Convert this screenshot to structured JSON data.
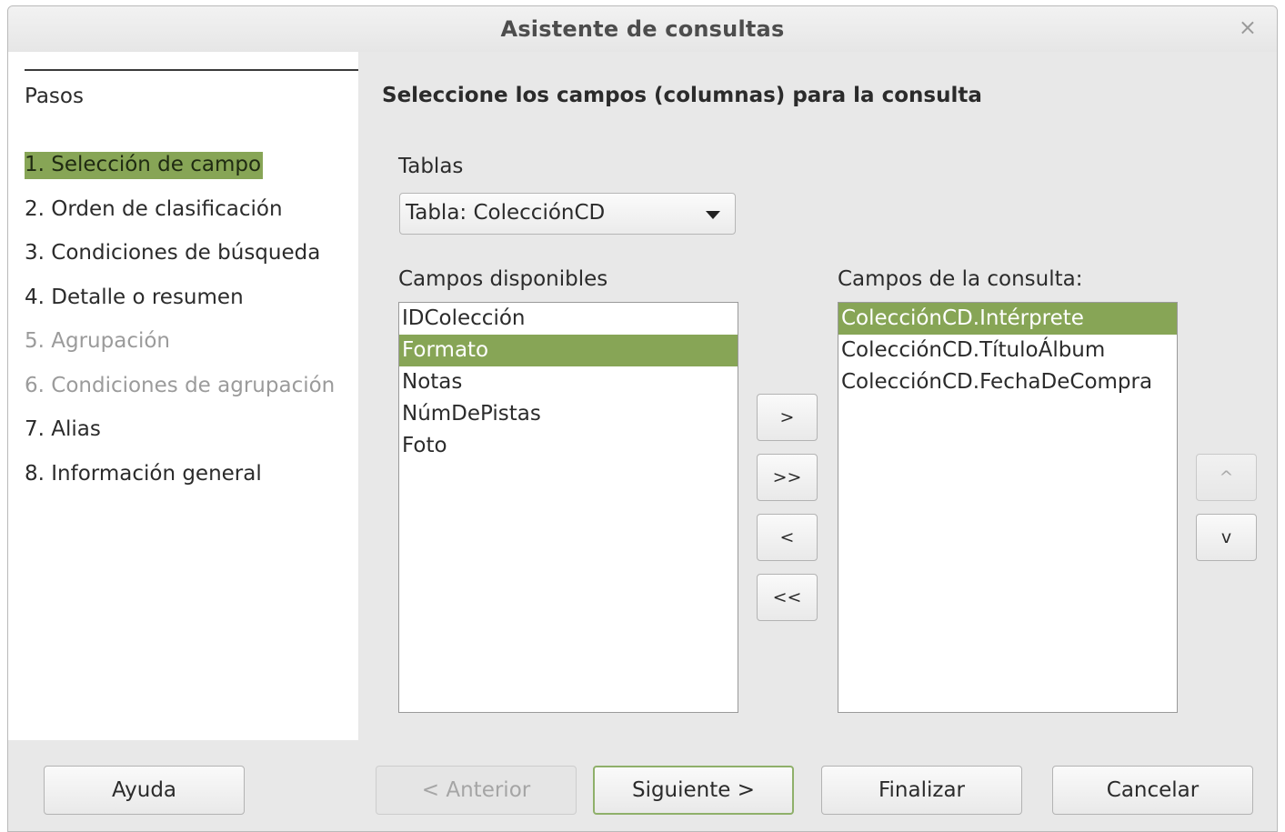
{
  "dialog": {
    "title": "Asistente de consultas",
    "close_glyph": "×"
  },
  "steps": {
    "title": "Pasos",
    "items": [
      {
        "label": "1. Selección de campo",
        "state": "active"
      },
      {
        "label": "2. Orden de clasificación",
        "state": "normal"
      },
      {
        "label": "3. Condiciones de búsqueda",
        "state": "normal"
      },
      {
        "label": "4. Detalle o resumen",
        "state": "normal"
      },
      {
        "label": "5. Agrupación",
        "state": "disabled"
      },
      {
        "label": "6. Condiciones de agrupación",
        "state": "disabled"
      },
      {
        "label": "7. Alias",
        "state": "normal"
      },
      {
        "label": "8. Información general",
        "state": "normal"
      }
    ]
  },
  "main": {
    "heading": "Seleccione los campos (columnas) para la consulta",
    "tables_label": "Tablas",
    "tables_selected": "Tabla: ColecciónCD",
    "available_label": "Campos disponibles",
    "available_fields": [
      "IDColección",
      "Formato",
      "Notas",
      "NúmDePistas",
      "Foto"
    ],
    "query_label": "Campos de la consulta:",
    "query_fields": [
      "ColecciónCD.Intérprete",
      "ColecciónCD.TítuloÁlbum",
      "ColecciónCD.FechaDeCompra"
    ],
    "move_buttons": {
      "add_one": ">",
      "add_all": ">>",
      "remove_one": "<",
      "remove_all": "<<",
      "up": "^",
      "down": "v"
    }
  },
  "footer": {
    "help": "Ayuda",
    "back": "< Anterior",
    "next": "Siguiente >",
    "finish": "Finalizar",
    "cancel": "Cancelar"
  },
  "colors": {
    "selection": "#87a556",
    "dialog_bg": "#e8e8e8",
    "default_button_border": "#8fb06a"
  }
}
